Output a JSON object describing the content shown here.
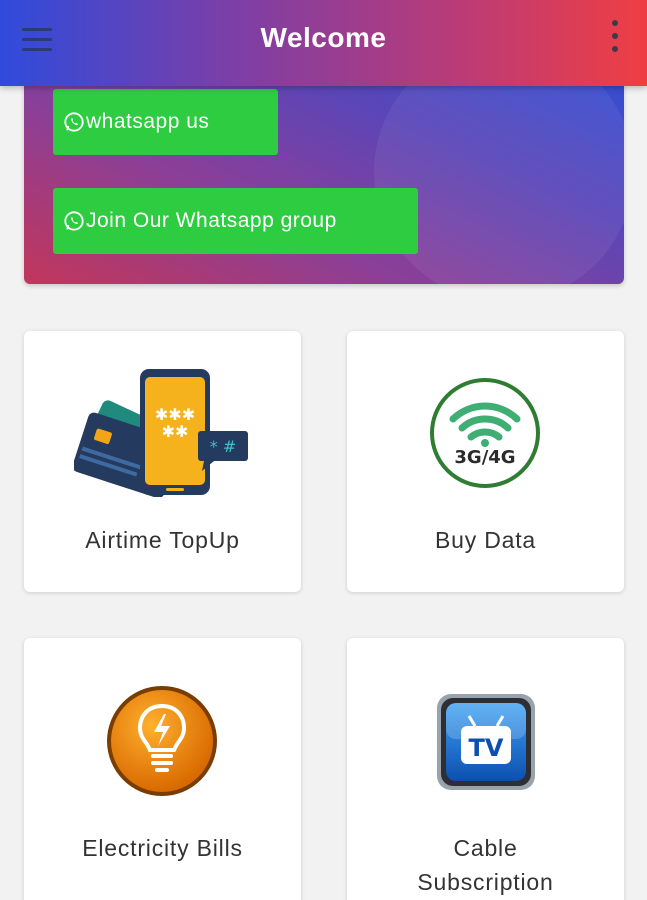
{
  "appbar": {
    "title": "Welcome",
    "menu_icon": "hamburger-menu-icon",
    "more_icon": "more-vertical-icon"
  },
  "banner": {
    "buttons": [
      {
        "label": "whatsapp us",
        "icon": "whatsapp-icon"
      },
      {
        "label": "Join Our Whatsapp group",
        "icon": "whatsapp-icon"
      }
    ]
  },
  "services": [
    {
      "label": "Airtime TopUp",
      "icon": "phone-cards-icon"
    },
    {
      "label": "Buy Data",
      "icon": "wifi-3g4g-icon",
      "icon_text": "3G/4G"
    },
    {
      "label": "Electricity Bills",
      "icon": "lightbulb-icon"
    },
    {
      "label_line1": "Cable",
      "label_line2": "Subscription",
      "icon": "tv-icon",
      "icon_text": "TV"
    }
  ],
  "colors": {
    "appbar_gradient": [
      "#2f4bdc",
      "#7a3fa8",
      "#b93b78",
      "#ef3e43"
    ],
    "whatsapp_green": "#2ecc40",
    "background": "#f2f2f2"
  }
}
